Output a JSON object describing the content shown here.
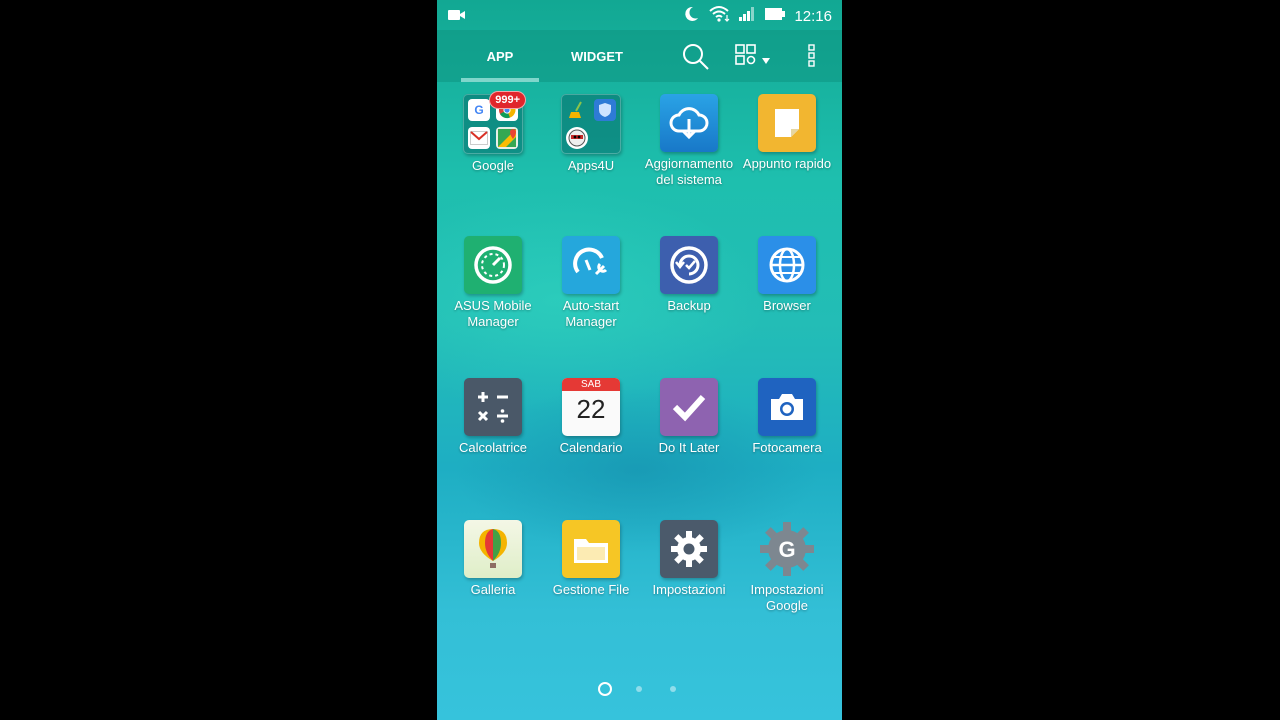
{
  "status_bar": {
    "time": "12:16"
  },
  "tabs": [
    {
      "label": "APP"
    },
    {
      "label": "WIDGET"
    }
  ],
  "toolbar_icons": [
    "search-icon",
    "layout-options-icon",
    "overflow-menu-icon"
  ],
  "apps": [
    {
      "label": "Google",
      "badge": "999+"
    },
    {
      "label": "Apps4U"
    },
    {
      "label": "Aggiornamento del sistema"
    },
    {
      "label": "Appunto rapido"
    },
    {
      "label": "ASUS Mobile Manager"
    },
    {
      "label": "Auto-start Manager"
    },
    {
      "label": "Backup"
    },
    {
      "label": "Browser"
    },
    {
      "label": "Calcolatrice"
    },
    {
      "label": "Calendario",
      "day_name": "SAB",
      "day_number": "22"
    },
    {
      "label": "Do It Later"
    },
    {
      "label": "Fotocamera"
    },
    {
      "label": "Galleria"
    },
    {
      "label": "Gestione File"
    },
    {
      "label": "Impostazioni"
    },
    {
      "label": "Impostazioni Google"
    }
  ],
  "page_indicator": {
    "pages": 3,
    "current": 1
  },
  "colors": {
    "wallpaper_top": "#12a893",
    "wallpaper_bottom": "#36c3dc",
    "badge": "#e0262b"
  }
}
